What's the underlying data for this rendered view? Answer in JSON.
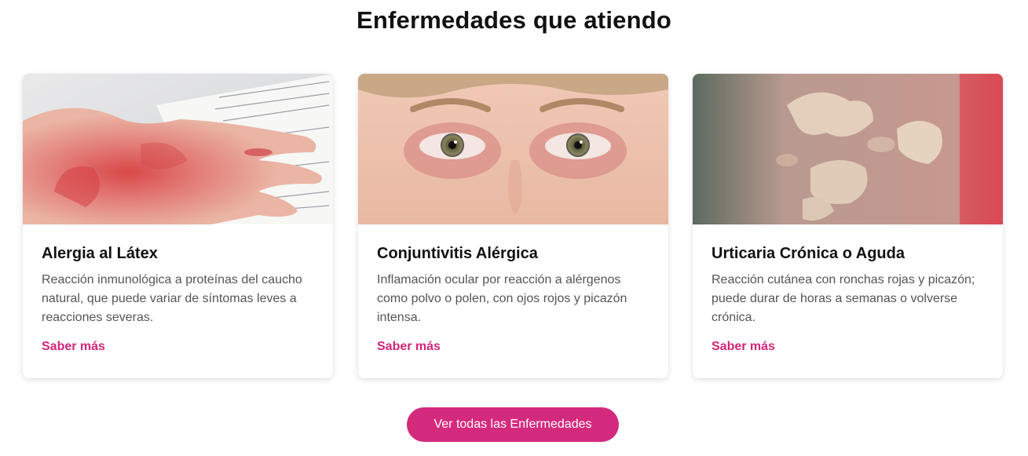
{
  "section": {
    "title": "Enfermedades que atiendo"
  },
  "cards": [
    {
      "title": "Alergia al Látex",
      "description": "Reacción inmunológica a proteínas del caucho natural, que puede variar de síntomas leves a reacciones severas.",
      "link": "Saber más",
      "image": "hand-rash-photo"
    },
    {
      "title": "Conjuntivitis Alérgica",
      "description": "Inflamación ocular por reacción a alérgenos como polvo o polen, con ojos rojos y picazón intensa.",
      "link": "Saber más",
      "image": "red-eyes-photo"
    },
    {
      "title": "Urticaria Crónica o Aguda",
      "description": "Reacción cutánea con ronchas rojas y picazón; puede durar de horas a semanas o volverse crónica.",
      "link": "Saber más",
      "image": "hives-skin-photo"
    }
  ],
  "cta": {
    "label": "Ver todas las Enfermedades"
  },
  "colors": {
    "accent": "#d42a7d",
    "link": "#d2257a",
    "title": "#111111",
    "text": "#555555"
  }
}
